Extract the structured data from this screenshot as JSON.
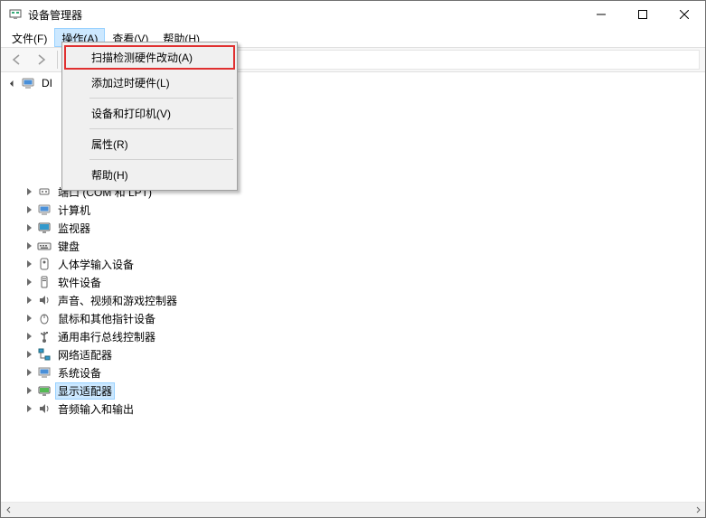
{
  "window": {
    "title": "设备管理器"
  },
  "menubar": {
    "items": [
      {
        "label": "文件(F)"
      },
      {
        "label": "操作(A)",
        "active": true
      },
      {
        "label": "查看(V)"
      },
      {
        "label": "帮助(H)"
      }
    ]
  },
  "dropdown": {
    "items": [
      {
        "label": "扫描检测硬件改动(A)",
        "highlighted": true
      },
      {
        "label": "添加过时硬件(L)"
      },
      {
        "sep": true
      },
      {
        "label": "设备和打印机(V)"
      },
      {
        "sep": true
      },
      {
        "label": "属性(R)"
      },
      {
        "sep": true
      },
      {
        "label": "帮助(H)"
      }
    ]
  },
  "tree": {
    "root": {
      "label": "DI",
      "expanded": true
    },
    "nodes": [
      {
        "label": "端口 (COM 和 LPT)",
        "icon": "port-icon"
      },
      {
        "label": "计算机",
        "icon": "computer-icon"
      },
      {
        "label": "监视器",
        "icon": "monitor-icon"
      },
      {
        "label": "键盘",
        "icon": "keyboard-icon"
      },
      {
        "label": "人体学输入设备",
        "icon": "hid-icon"
      },
      {
        "label": "软件设备",
        "icon": "software-icon"
      },
      {
        "label": "声音、视频和游戏控制器",
        "icon": "audio-icon"
      },
      {
        "label": "鼠标和其他指针设备",
        "icon": "mouse-icon"
      },
      {
        "label": "通用串行总线控制器",
        "icon": "usb-icon"
      },
      {
        "label": "网络适配器",
        "icon": "network-icon"
      },
      {
        "label": "系统设备",
        "icon": "system-icon"
      },
      {
        "label": "显示适配器",
        "icon": "display-icon",
        "selected": true
      },
      {
        "label": "音频输入和输出",
        "icon": "speaker-icon"
      }
    ],
    "hidden_nodes_count": 5
  }
}
